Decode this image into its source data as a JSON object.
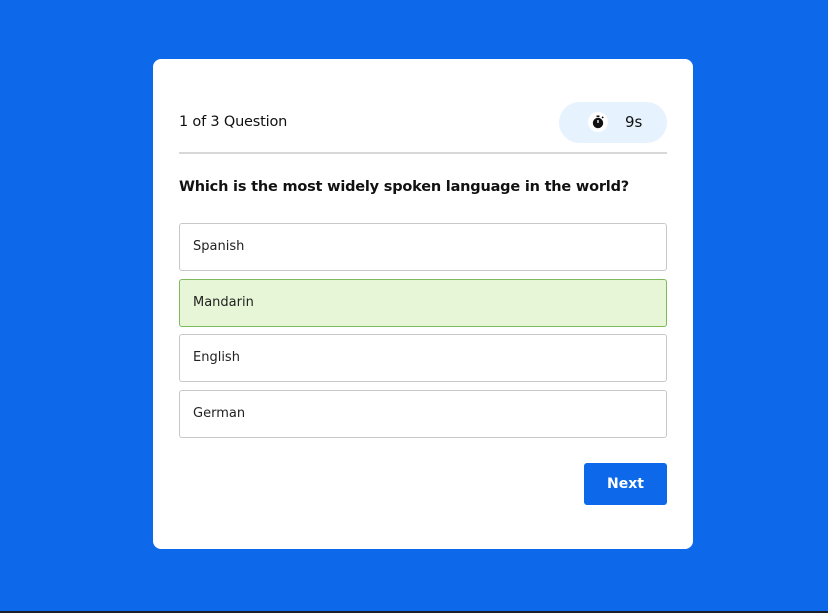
{
  "quiz": {
    "counter": "1 of 3 Question",
    "timer": {
      "icon": "stopwatch-icon",
      "value": "9s"
    },
    "question": "Which is the most widely spoken language in the world?",
    "options": [
      {
        "label": "Spanish",
        "state": "default"
      },
      {
        "label": "Mandarin",
        "state": "correct"
      },
      {
        "label": "English",
        "state": "default"
      },
      {
        "label": "German",
        "state": "default"
      }
    ],
    "next_label": "Next"
  },
  "colors": {
    "background": "#0d69ea",
    "card": "#ffffff",
    "timer_bg": "#e6f2fd",
    "correct_bg": "#e7f6d7",
    "correct_border": "#7fbb5c",
    "button": "#0d69ea"
  }
}
